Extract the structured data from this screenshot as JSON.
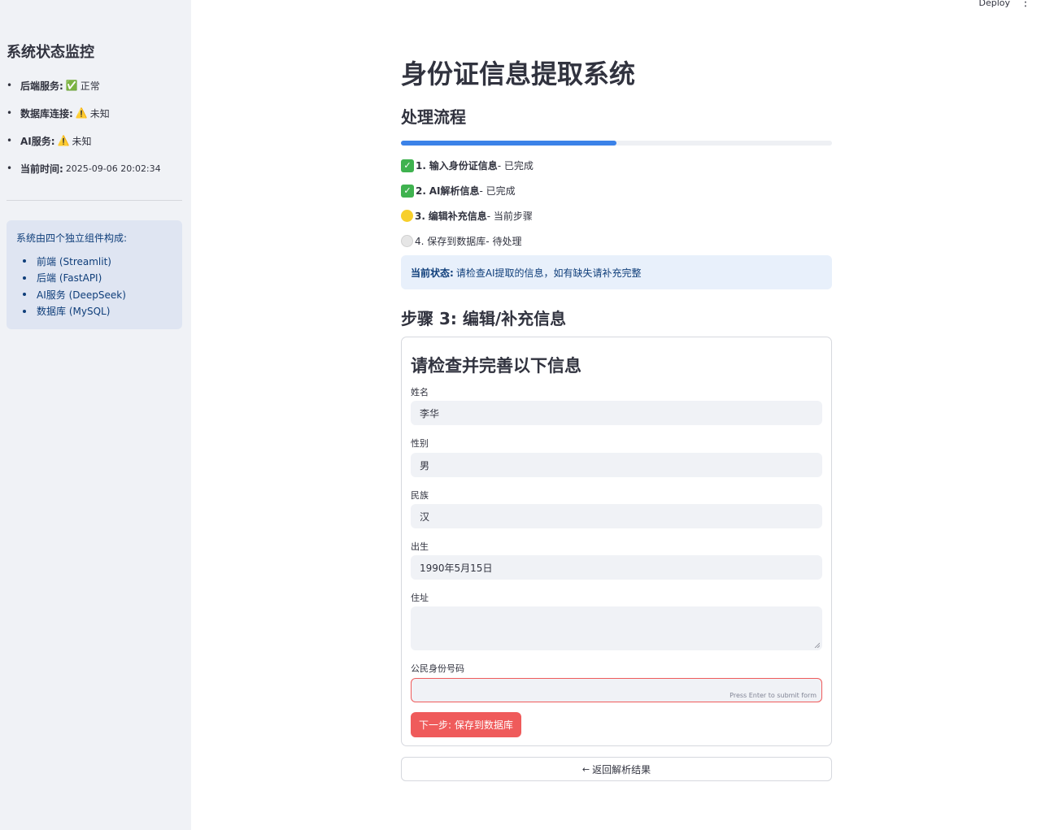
{
  "sidebar": {
    "title": "系统状态监控",
    "status_items": [
      {
        "key": "后端服务:",
        "emoji": "✅",
        "value": "正常"
      },
      {
        "key": "数据库连接:",
        "emoji": "⚠️",
        "value": "未知"
      },
      {
        "key": "AI服务:",
        "emoji": "⚠️",
        "value": "未知"
      },
      {
        "key": "当前时间:",
        "emoji": "",
        "value": "2025-09-06 20:02:34"
      }
    ],
    "info": {
      "intro": "系统由四个独立组件构成:",
      "components": [
        "前端 (Streamlit)",
        "后端 (FastAPI)",
        "AI服务 (DeepSeek)",
        "数据库 (MySQL)"
      ]
    }
  },
  "topbar": {
    "deploy_label": "Deploy",
    "menu_icon": "⋮"
  },
  "main": {
    "title": "身份证信息提取系统",
    "subtitle": "处理流程",
    "progress": 0.5,
    "steps": [
      {
        "icon": "check-icon",
        "num": "1.",
        "label": "输入身份证信息",
        "status": " - 已完成"
      },
      {
        "icon": "check-icon",
        "num": "2.",
        "label": "AI解析信息",
        "status": " - 已完成"
      },
      {
        "icon": "yellow-circle-icon",
        "num": "3.",
        "label": "编辑补充信息",
        "status": " - 当前步骤"
      },
      {
        "icon": "white-circle-icon",
        "num": "4.",
        "label": "保存到数据库",
        "status": " - 待处理"
      }
    ],
    "current_state": {
      "key": "当前状态:",
      "text": "请检查AI提取的信息，如有缺失请补充完整"
    },
    "step_heading": "步骤 3: 编辑/补充信息",
    "form": {
      "heading": "请检查并完善以下信息",
      "fields": [
        {
          "label": "姓名",
          "value": "李华"
        },
        {
          "label": "性别",
          "value": "男"
        },
        {
          "label": "民族",
          "value": "汉"
        },
        {
          "label": "出生",
          "value": "1990年5月15日"
        },
        {
          "label": "住址",
          "value": ""
        },
        {
          "label": "公民身份号码",
          "value": ""
        }
      ],
      "hint": "Press Enter to submit form",
      "submit_label": "下一步: 保存到数据库"
    },
    "back_label": "返回解析结果"
  },
  "colors": {
    "accent": "#3b82e8",
    "primary_button": "#ef5b5b",
    "sidebar_bg": "#f0f2f6",
    "info_bg": "#dfe5f2"
  }
}
